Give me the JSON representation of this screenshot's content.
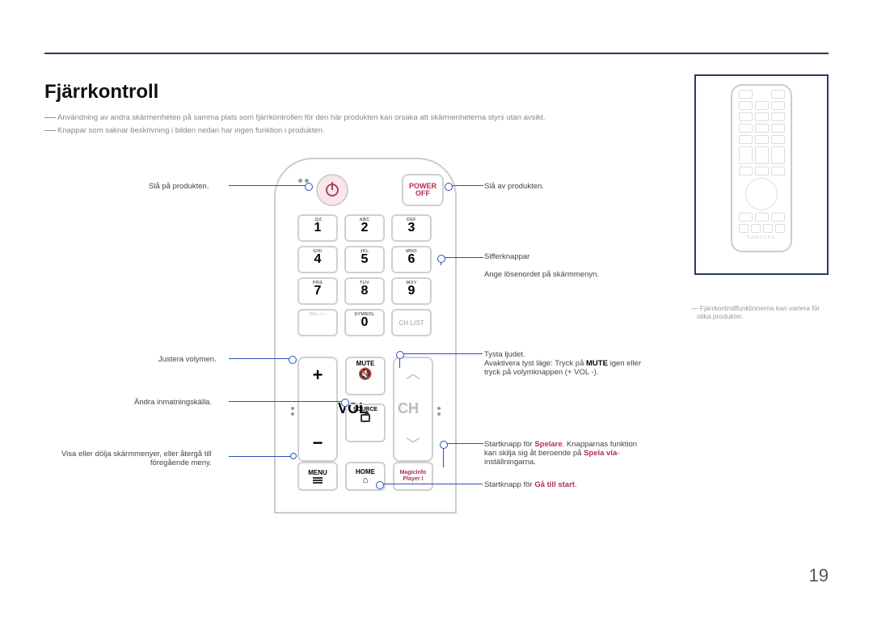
{
  "page": {
    "title": "Fjärrkontroll",
    "number": "19"
  },
  "notes": {
    "n1": "Användning av andra skärmenheten på samma plats som fjärrkontrollen för den här produkten kan orsaka att skärmenheterna styrs utan avsikt.",
    "n2": "Knappar som saknar beskrivning i bilden nedan har ingen funktion i produkten."
  },
  "buttons": {
    "power_off_l1": "POWER",
    "power_off_l2": "OFF",
    "vol": "VOL",
    "ch": "CH",
    "mute": "MUTE",
    "source": "SOURCE",
    "menu": "MENU",
    "home": "HOME",
    "magic_l1": "MagicInfo",
    "magic_l2": "Player I",
    "chlist": "CH LIST",
    "symbol": "SYMBOL",
    "del": "DEL-/—"
  },
  "keys": {
    "k1": "1",
    "k2": "2",
    "k3": "3",
    "k4": "4",
    "k5": "5",
    "k6": "6",
    "k7": "7",
    "k8": "8",
    "k9": "9",
    "k0": "0",
    "s1": ".QZ",
    "s2": "ABC",
    "s3": "DEF",
    "s4": "GHI",
    "s5": "JKL",
    "s6": "MNO",
    "s7": "PRS",
    "s8": "TUV",
    "s9": "WXY"
  },
  "callouts": {
    "left": {
      "power_on": "Slå på produkten.",
      "volume": "Justera volymen.",
      "source": "Ändra inmatningskälla.",
      "menu_l1": "Visa eller dölja skärmmenyer, eller återgå till",
      "menu_l2": "föregående meny."
    },
    "right": {
      "power_off": "Slå av produkten.",
      "num_l1": "Sifferknappar",
      "num_l2": "Ange lösenordet på skärmmenyn.",
      "mute_l1": "Tysta ljudet.",
      "mute_l2a": "Avaktivera tyst läge: Tryck på ",
      "mute_l2b": "MUTE",
      "mute_l2c": " igen eller",
      "mute_l3": "tryck på volymknappen (+ VOL -).",
      "magic_l1a": "Startknapp för ",
      "magic_l1b": "Spelare",
      "magic_l1c": ". Knapparnas funktion",
      "magic_l2a": "kan skilja sig åt beroende på ",
      "magic_l2b": "Spela via",
      "magic_l2c": "-",
      "magic_l3": "inställningarna.",
      "home_a": "Startknapp för ",
      "home_b": "Gå till start",
      "home_c": "."
    }
  },
  "side": {
    "note_l1": "Fjärrkontrollfunktionerna kan variera för",
    "note_l2": "olika produkter.",
    "brand": "SAMSUNG"
  }
}
